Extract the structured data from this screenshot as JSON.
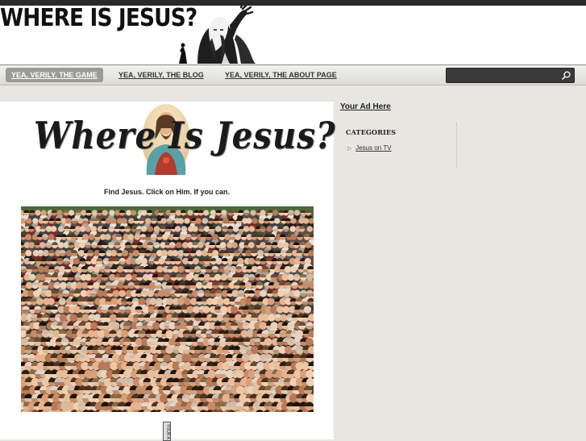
{
  "header": {
    "site_title": "WHERE IS JESUS?"
  },
  "nav": {
    "items": [
      {
        "label": "YEA, VERILY, THE GAME",
        "active": true
      },
      {
        "label": "YEA, VERILY, THE BLOG",
        "active": false
      },
      {
        "label": "YEA, VERILY, THE ABOUT PAGE",
        "active": false
      }
    ],
    "search": {
      "value": "",
      "icon": "search-icon"
    }
  },
  "main": {
    "logo_text": "Where Is Jesus?",
    "tagline": "Find Jesus. Click on Him. If you can.",
    "bottom_tab_text": "YOUR A"
  },
  "sidebar": {
    "ad_link": "Your Ad Here",
    "categories_heading": "CATEGORIES",
    "categories": [
      "Jesus on TV"
    ]
  },
  "colors": {
    "page_bg": "#e7e6e1",
    "topbar": "#2a2a2a",
    "nav_active_bg": "#9a9a96",
    "search_bg": "#3a3a3a"
  }
}
